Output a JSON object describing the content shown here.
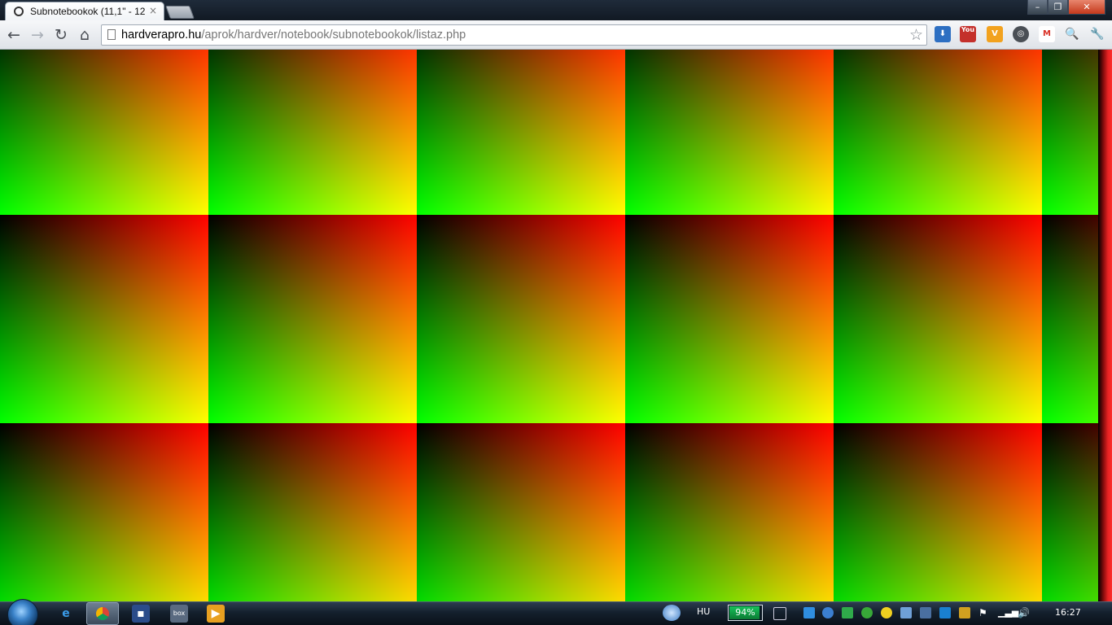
{
  "browser": {
    "tab_title": "Subnotebookok (11,1\" - 12",
    "tab_close": "×",
    "window_buttons": {
      "minimize": "–",
      "restore": "❐",
      "close": "✕"
    },
    "nav": {
      "back": "←",
      "forward": "→",
      "reload": "↻",
      "home": "⌂"
    },
    "url_host": "hardverapro.hu",
    "url_path": "/aprok/hardver/notebook/subnotebookok/listaz.php",
    "bookmark_star": "☆",
    "extensions": [
      {
        "name": "download-extension",
        "label": "⬇",
        "color": "#2d6fc2"
      },
      {
        "name": "youtube-extension",
        "label": "You",
        "color": "#c4302b"
      },
      {
        "name": "vivaldi-extension",
        "label": "V",
        "color": "#f2a21e"
      },
      {
        "name": "steering-extension",
        "label": "◎",
        "color": "#4a4f55"
      },
      {
        "name": "gmail-extension",
        "label": "M",
        "color": "#d93025"
      },
      {
        "name": "search-extension",
        "label": "🔍",
        "color": "#5a6069"
      },
      {
        "name": "wrench-menu",
        "label": "🔧",
        "color": "#5a6069"
      }
    ]
  },
  "taskbar": {
    "language": "HU",
    "battery_percent": 94,
    "battery_label": "94%",
    "clock": "16:27"
  }
}
